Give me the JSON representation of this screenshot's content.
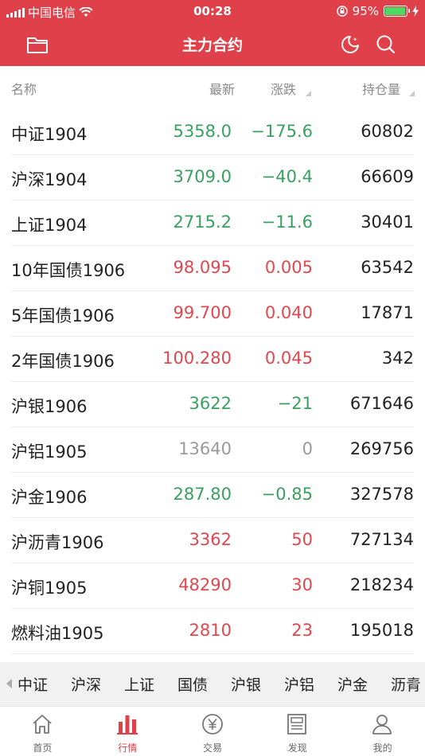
{
  "status_bar": {
    "carrier": "中国电信",
    "time": "00:28",
    "battery": "95%",
    "battery_level": 0.95
  },
  "navbar": {
    "title": "主力合约",
    "left_icon": "folder-icon",
    "right_icons": [
      "moon-icon",
      "search-icon"
    ]
  },
  "table": {
    "headers": {
      "name": "名称",
      "price": "最新",
      "change": "涨跌",
      "oi": "持仓量"
    },
    "rows": [
      {
        "name": "中证1904",
        "price": "5358.0",
        "change": "−175.6",
        "oi": "60802",
        "trend": "down"
      },
      {
        "name": "沪深1904",
        "price": "3709.0",
        "change": "−40.4",
        "oi": "66609",
        "trend": "down"
      },
      {
        "name": "上证1904",
        "price": "2715.2",
        "change": "−11.6",
        "oi": "30401",
        "trend": "down"
      },
      {
        "name": "10年国债1906",
        "price": "98.095",
        "change": "0.005",
        "oi": "63542",
        "trend": "up"
      },
      {
        "name": "5年国债1906",
        "price": "99.700",
        "change": "0.040",
        "oi": "17871",
        "trend": "up"
      },
      {
        "name": "2年国债1906",
        "price": "100.280",
        "change": "0.045",
        "oi": "342",
        "trend": "up"
      },
      {
        "name": "沪银1906",
        "price": "3622",
        "change": "−21",
        "oi": "671646",
        "trend": "down"
      },
      {
        "name": "沪铝1905",
        "price": "13640",
        "change": "0",
        "oi": "269756",
        "trend": "flat"
      },
      {
        "name": "沪金1906",
        "price": "287.80",
        "change": "−0.85",
        "oi": "327578",
        "trend": "down"
      },
      {
        "name": "沪沥青1906",
        "price": "3362",
        "change": "50",
        "oi": "727134",
        "trend": "up"
      },
      {
        "name": "沪铜1905",
        "price": "48290",
        "change": "30",
        "oi": "218234",
        "trend": "up"
      },
      {
        "name": "燃料油1905",
        "price": "2810",
        "change": "23",
        "oi": "195018",
        "trend": "up"
      }
    ]
  },
  "categories": [
    "中证",
    "沪深",
    "上证",
    "国债",
    "沪银",
    "沪铝",
    "沪金",
    "沥青"
  ],
  "tabbar": {
    "items": [
      {
        "label": "首页",
        "icon": "home-icon"
      },
      {
        "label": "行情",
        "icon": "market-chart-icon"
      },
      {
        "label": "交易",
        "icon": "yuan-coin-icon"
      },
      {
        "label": "发现",
        "icon": "news-icon"
      },
      {
        "label": "我的",
        "icon": "profile-icon"
      }
    ],
    "active_index": 1
  },
  "colors": {
    "brand": "#e04049",
    "up": "#e0474e",
    "down": "#3aa060",
    "flat": "#9a9a9a"
  }
}
